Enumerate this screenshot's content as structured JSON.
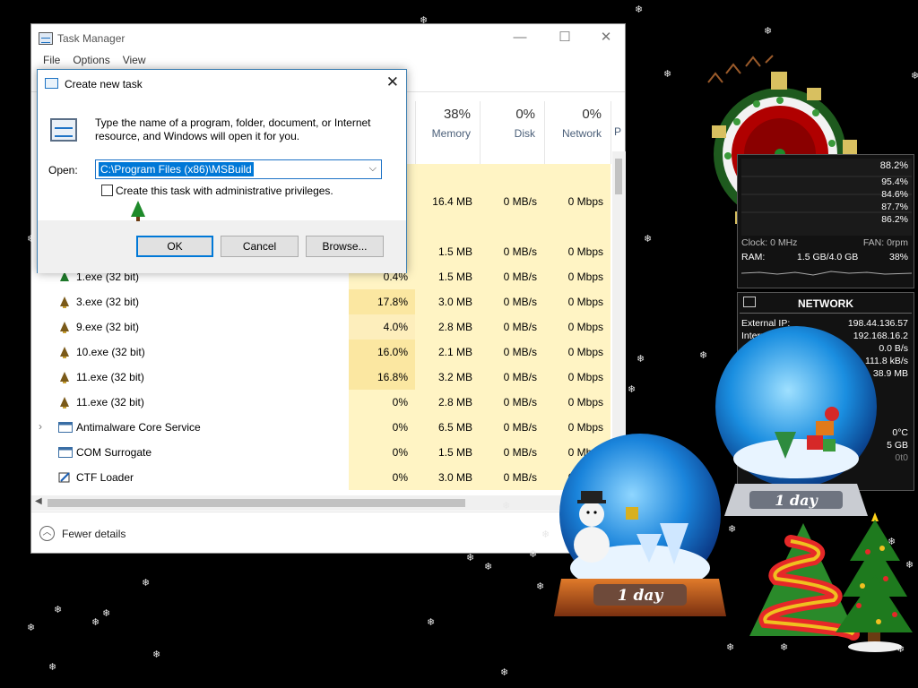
{
  "task_manager": {
    "title": "Task Manager",
    "menu": [
      "File",
      "Options",
      "View"
    ],
    "window_buttons": {
      "minimize": "—",
      "maximize": "☐",
      "close": "✕"
    },
    "columns": [
      {
        "pct": "38%",
        "label": "Memory"
      },
      {
        "pct": "0%",
        "label": "Disk"
      },
      {
        "pct": "0%",
        "label": "Network"
      }
    ],
    "rows": [
      {
        "name": "",
        "cpu": "",
        "mem": "",
        "disk": "",
        "net": "",
        "icon": "blank"
      },
      {
        "name": "",
        "cpu": "",
        "mem": "16.4 MB",
        "disk": "0 MB/s",
        "net": "0 Mbps",
        "icon": "blank"
      },
      {
        "name": "",
        "cpu": "",
        "mem": "",
        "disk": "",
        "net": "",
        "icon": "blank"
      },
      {
        "name": "",
        "cpu": "",
        "mem": "1.5 MB",
        "disk": "0 MB/s",
        "net": "0 Mbps",
        "icon": "blank"
      },
      {
        "name": "1.exe (32 bit)",
        "cpu": "0.4%",
        "mem": "1.5 MB",
        "disk": "0 MB/s",
        "net": "0 Mbps",
        "icon": "tree"
      },
      {
        "name": "3.exe (32 bit)",
        "cpu": "17.8%",
        "mem": "3.0 MB",
        "disk": "0 MB/s",
        "net": "0 Mbps",
        "icon": "bell"
      },
      {
        "name": "9.exe (32 bit)",
        "cpu": "4.0%",
        "mem": "2.8 MB",
        "disk": "0 MB/s",
        "net": "0 Mbps",
        "icon": "bell"
      },
      {
        "name": "10.exe (32 bit)",
        "cpu": "16.0%",
        "mem": "2.1 MB",
        "disk": "0 MB/s",
        "net": "0 Mbps",
        "icon": "bell"
      },
      {
        "name": "11.exe (32 bit)",
        "cpu": "16.8%",
        "mem": "3.2 MB",
        "disk": "0 MB/s",
        "net": "0 Mbps",
        "icon": "bell"
      },
      {
        "name": "11.exe (32 bit)",
        "cpu": "0%",
        "mem": "2.8 MB",
        "disk": "0 MB/s",
        "net": "0 Mbps",
        "icon": "bell"
      },
      {
        "name": "Antimalware Core Service",
        "cpu": "0%",
        "mem": "6.5 MB",
        "disk": "0 MB/s",
        "net": "0 Mbps",
        "icon": "service",
        "expandable": true
      },
      {
        "name": "COM Surrogate",
        "cpu": "0%",
        "mem": "1.5 MB",
        "disk": "0 MB/s",
        "net": "0 Mbps",
        "icon": "service"
      },
      {
        "name": "CTF Loader",
        "cpu": "0%",
        "mem": "3.0 MB",
        "disk": "0 MB/s",
        "net": "0 Mbps",
        "icon": "pen"
      }
    ],
    "footer_label": "Fewer details"
  },
  "dialog": {
    "title": "Create new task",
    "message": "Type the name of a program, folder, document, or Internet resource, and Windows will open it for you.",
    "open_label": "Open:",
    "open_value": "C:\\Program Files (x86)\\MSBuild",
    "checkbox_label": "Create this task with administrative privileges.",
    "ok": "OK",
    "cancel": "Cancel",
    "browse": "Browse..."
  },
  "gadgets": {
    "cpu": {
      "values": [
        "88.2%",
        "95.4%",
        "84.6%",
        "87.7%",
        "86.2%"
      ],
      "clock_label": "Clock: 0 MHz",
      "fan_label": "FAN: 0rpm"
    },
    "ram": {
      "label": "RAM:",
      "value": "1.5 GB/4.0 GB",
      "pct": "38%"
    },
    "network": {
      "title": "NETWORK",
      "external_label": "External IP:",
      "external_ip": "198.44.136.57",
      "internal_label": "Internal",
      "internal_ip": "192.168.16.2",
      "rate1": "0.0 B/s",
      "rate2": "111.8 kB/s",
      "rate3": "38.9 MB"
    },
    "weather": {
      "temp": "0°C",
      "extra": "5 GB",
      "extra2": "0t0"
    },
    "snowglobe_left_label": "1 day",
    "snowglobe_right_label": "1 day"
  },
  "colors": {
    "cpu_high": "#f9e6a3",
    "cpu_mid": "#fbeebb",
    "cell_bg": "#fff4c4",
    "accent": "#0078d7"
  }
}
